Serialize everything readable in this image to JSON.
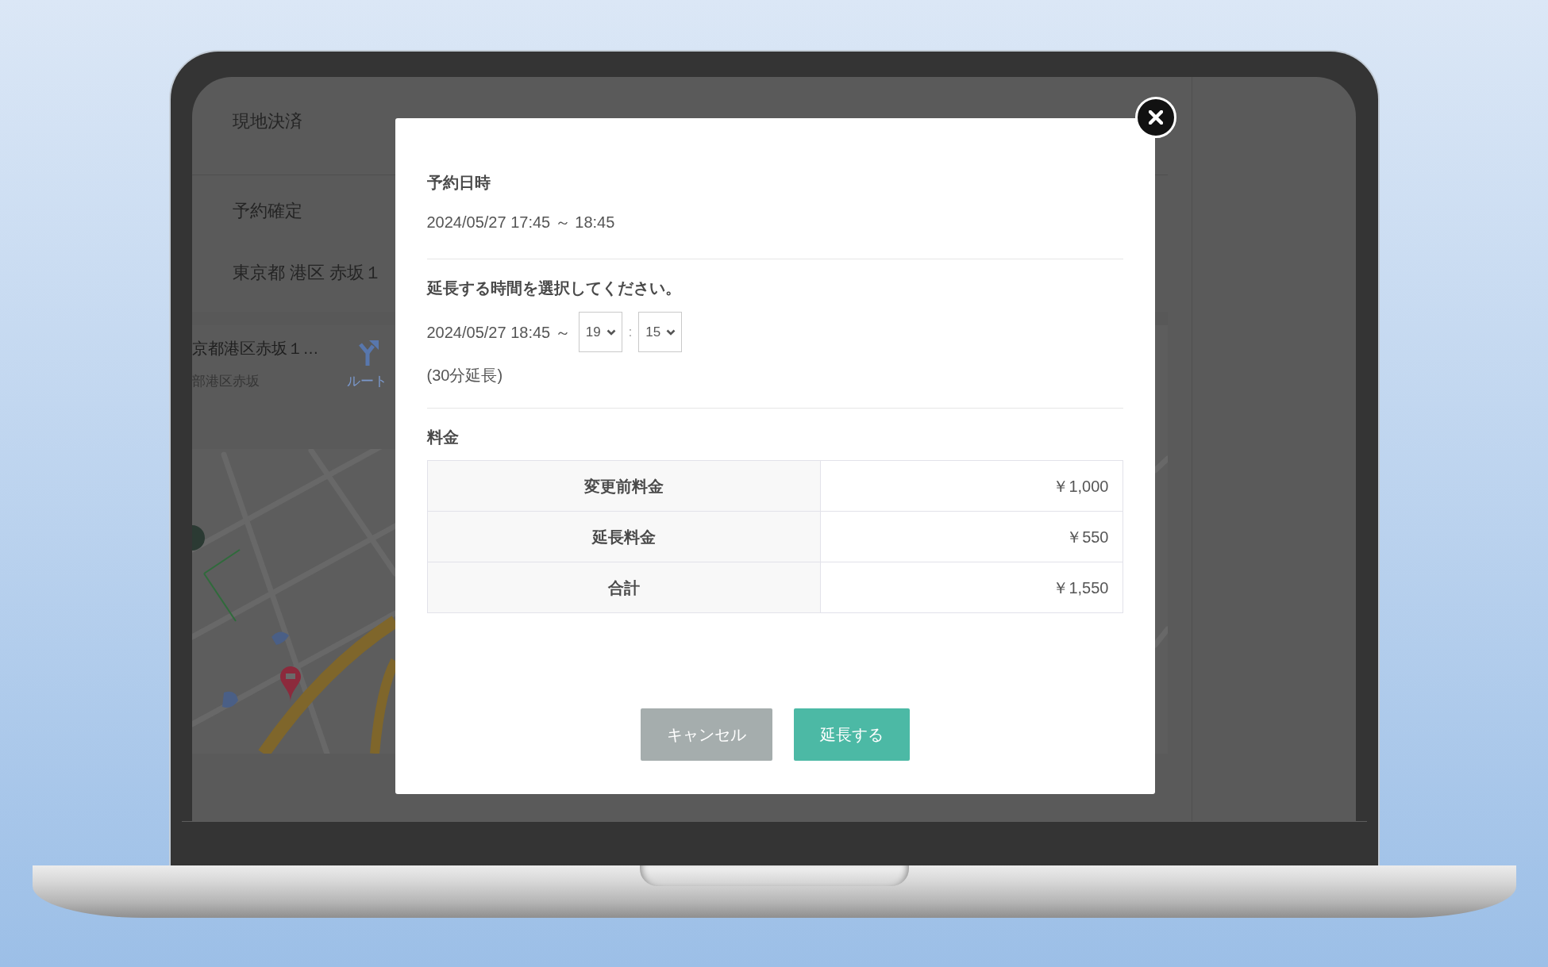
{
  "background_page": {
    "sections": [
      {
        "rows": [
          "現地決済"
        ]
      },
      {
        "rows": [
          "予約確定",
          "東京都 港区 赤坂１"
        ]
      }
    ],
    "map": {
      "place_name": "京都港区赤坂１…",
      "place_address": "部港区赤坂",
      "route_label": "ルート"
    }
  },
  "modal": {
    "reservation": {
      "heading": "予約日時",
      "datetime": "2024/05/27 17:45 ～ 18:45"
    },
    "extension": {
      "heading": "延長する時間を選択してください。",
      "start": "2024/05/27 18:45 ～",
      "hour": "19",
      "separator": ":",
      "minute": "15",
      "note": "(30分延長)"
    },
    "fees": {
      "heading": "料金",
      "rows": [
        {
          "label": "変更前料金",
          "amount": "￥1,000"
        },
        {
          "label": "延長料金",
          "amount": "￥550"
        },
        {
          "label": "合計",
          "amount": "￥1,550"
        }
      ]
    },
    "buttons": [
      {
        "label": "キャンセル",
        "kind": "cancel"
      },
      {
        "label": "延長する",
        "kind": "primary"
      }
    ]
  }
}
